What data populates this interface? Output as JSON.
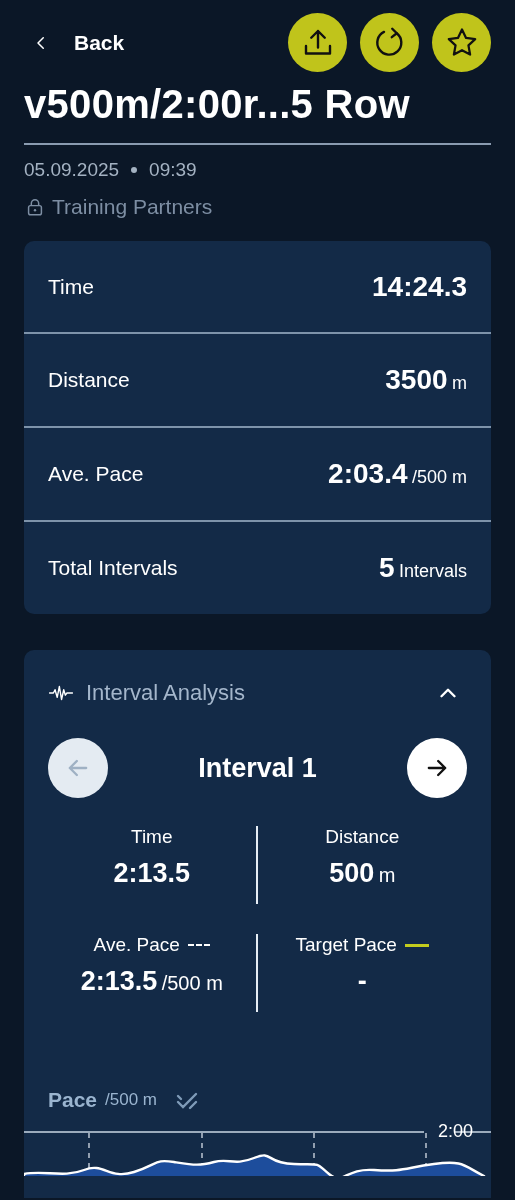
{
  "header": {
    "back_label": "Back",
    "actions": [
      {
        "kind": "share"
      },
      {
        "kind": "redo"
      },
      {
        "kind": "favorite",
        "selected": false
      }
    ]
  },
  "title": "v500m/2:00r...5 Row",
  "date": "05.09.2025",
  "time": "09:39",
  "visibility": "Training Partners",
  "summary": [
    {
      "label": "Time",
      "value": "14:24.3"
    },
    {
      "label": "Distance",
      "value": "3500",
      "unit": "m"
    },
    {
      "label": "Ave. Pace",
      "value": "2:03.4",
      "unit": "/500 m"
    },
    {
      "label": "Total Intervals",
      "value": "5",
      "unit": "Intervals"
    }
  ],
  "interval_analysis": {
    "title": "Interval Analysis",
    "expanded": true,
    "prev_disabled": true,
    "next_disabled": false,
    "interval_title": "Interval 1",
    "stats": [
      {
        "label": "Time",
        "value": "2:13.5"
      },
      {
        "label": "Distance",
        "value": "500",
        "unit": "m"
      },
      {
        "label": "Ave. Pace",
        "value": "2:13.5",
        "unit": "/500 m",
        "kind": "dashed"
      },
      {
        "label": "Target Pace",
        "value": "-",
        "kind": "solid",
        "color": "#c3cc1e"
      }
    ],
    "pace_chart": {
      "title": "Pace",
      "unit": "/500 m",
      "tick_label": "2:00"
    }
  }
}
